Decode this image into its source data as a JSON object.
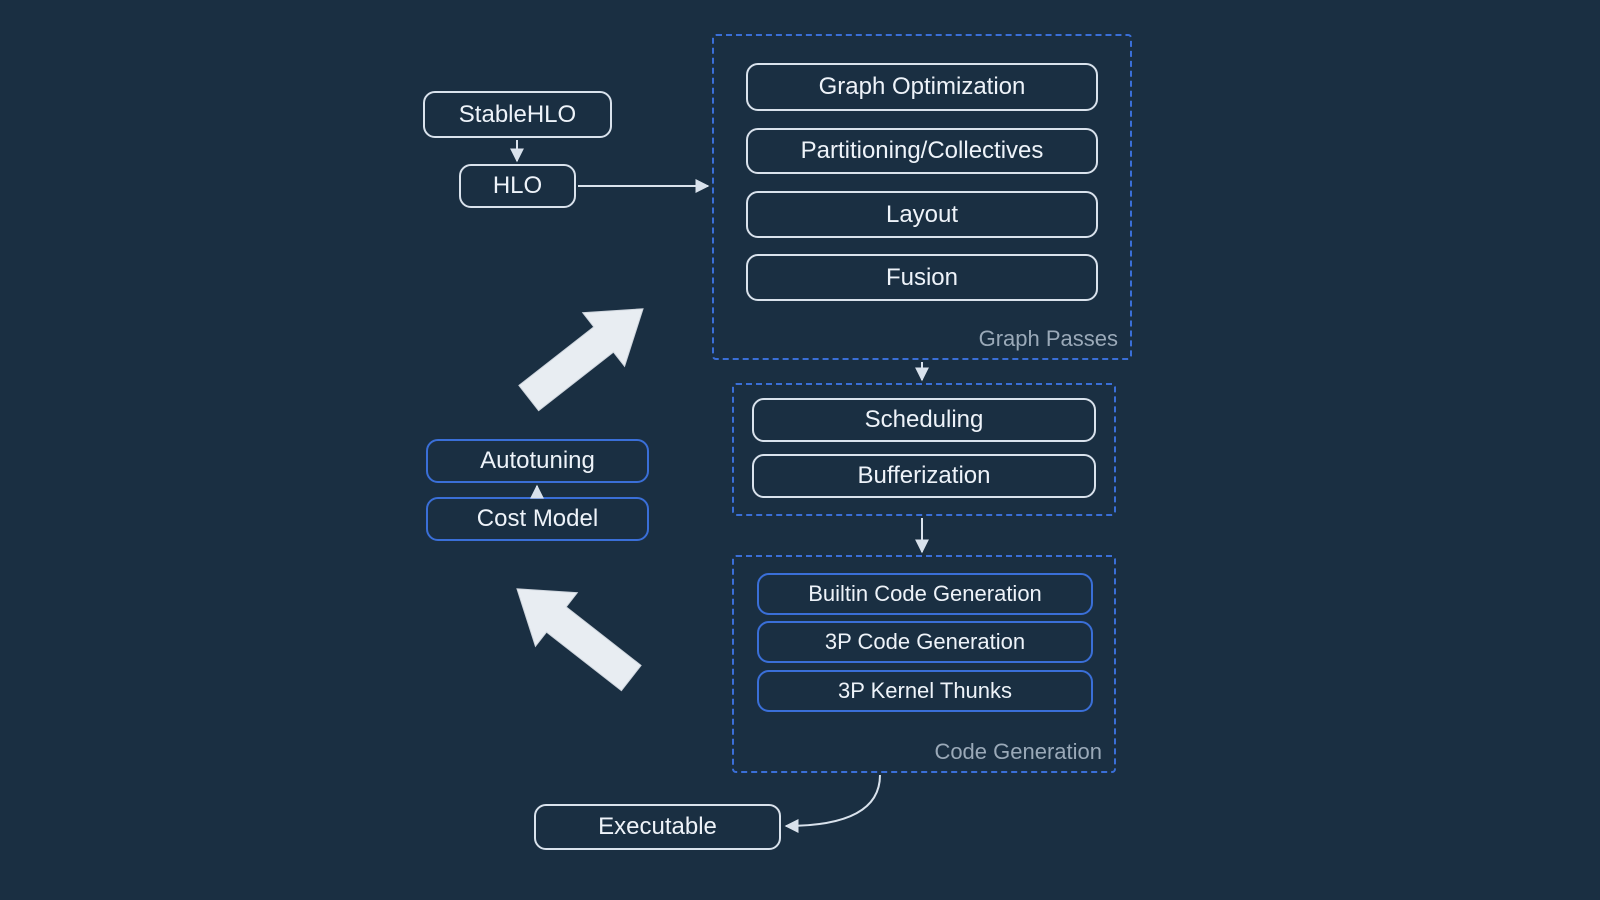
{
  "inputs": {
    "stablehlo": "StableHLO",
    "hlo": "HLO"
  },
  "graph_passes": {
    "label": "Graph Passes",
    "items": [
      "Graph Optimization",
      "Partitioning/Collectives",
      "Layout",
      "Fusion"
    ]
  },
  "middle_group": {
    "items": [
      "Scheduling",
      "Bufferization"
    ]
  },
  "codegen": {
    "label": "Code Generation",
    "items": [
      "Builtin Code Generation",
      "3P Code Generation",
      "3P Kernel Thunks"
    ]
  },
  "feedback": {
    "autotuning": "Autotuning",
    "cost_model": "Cost Model"
  },
  "output": {
    "executable": "Executable"
  }
}
